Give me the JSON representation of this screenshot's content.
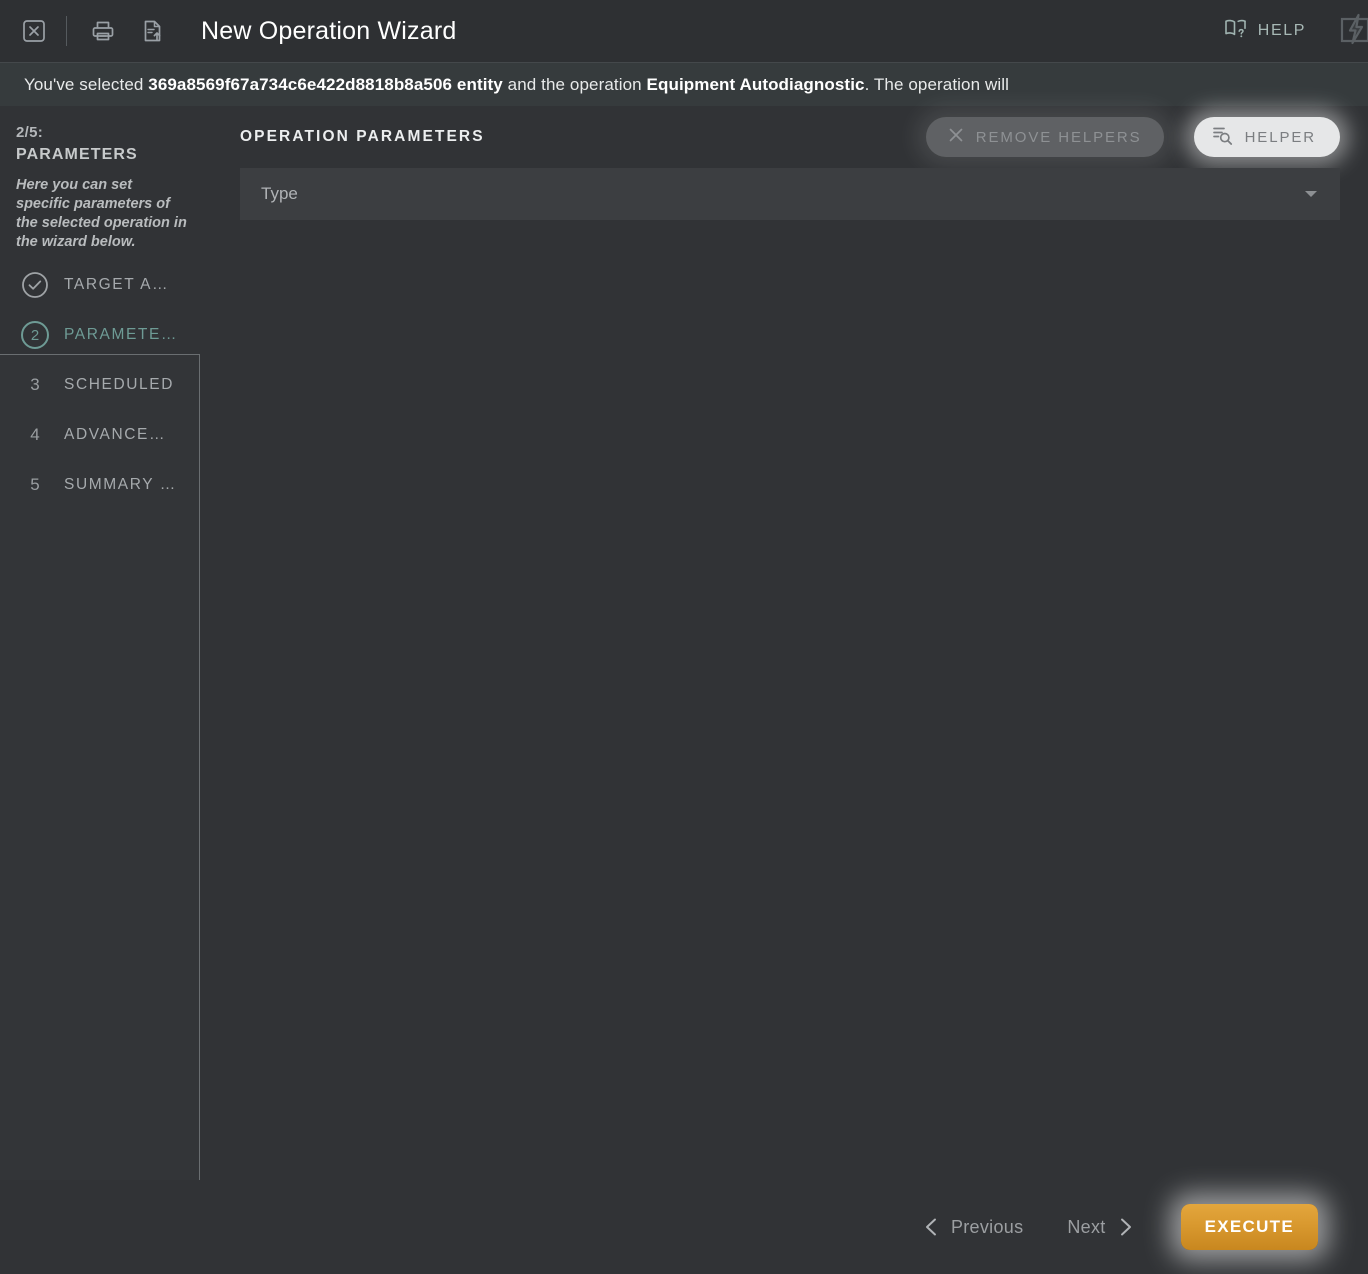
{
  "window": {
    "title": "New Operation Wizard",
    "toolbar_icons": [
      {
        "name": "close-icon",
        "label": "Close"
      },
      {
        "name": "print-icon",
        "label": "Print"
      },
      {
        "name": "export-document-icon",
        "label": "Export"
      }
    ],
    "help_label": "HELP",
    "help_icon": "book-question-icon",
    "flash_icon": "flash-panel-icon"
  },
  "banner": {
    "prefix": "You've selected ",
    "entity_id": "369a8569f67a734c6e422d8818b8a506 entity",
    "middle": " and the operation ",
    "operation": "Equipment Autodiagnostic",
    "suffix": ". The operation will"
  },
  "sidebar": {
    "step_counter": "2/5:",
    "step_name": "PARAMETERS",
    "description": "Here you can set specific parameters of the selected operation in the wizard below.",
    "steps": [
      {
        "mark": "check",
        "number": "1",
        "label": "TARGET A…",
        "state": "done"
      },
      {
        "mark": "number",
        "number": "2",
        "label": "PARAMETE…",
        "state": "active"
      },
      {
        "mark": "plain",
        "number": "3",
        "label": "SCHEDULED",
        "state": "pending"
      },
      {
        "mark": "plain",
        "number": "4",
        "label": "ADVANCE…",
        "state": "pending"
      },
      {
        "mark": "plain",
        "number": "5",
        "label": "SUMMARY …",
        "state": "pending"
      }
    ]
  },
  "main": {
    "section_title": "OPERATION PARAMETERS",
    "remove_helpers_label": "REMOVE HELPERS",
    "remove_helpers_icon": "close-x-icon",
    "helper_label": "HELPER",
    "helper_icon": "manage-search-icon",
    "parameters": [
      {
        "label": "Type",
        "value": "",
        "placeholder": "Type"
      }
    ]
  },
  "footer": {
    "previous_label": "Previous",
    "next_label": "Next",
    "execute_label": "EXECUTE"
  },
  "colors": {
    "background": "#313336",
    "topbar": "#2e3033",
    "banner": "#363b3d",
    "field": "#3c3e41",
    "accent_teal": "#6e9b95",
    "accent_orange": "#d9992f",
    "text_primary": "#eceeef",
    "text_muted": "#9a9ea1"
  }
}
